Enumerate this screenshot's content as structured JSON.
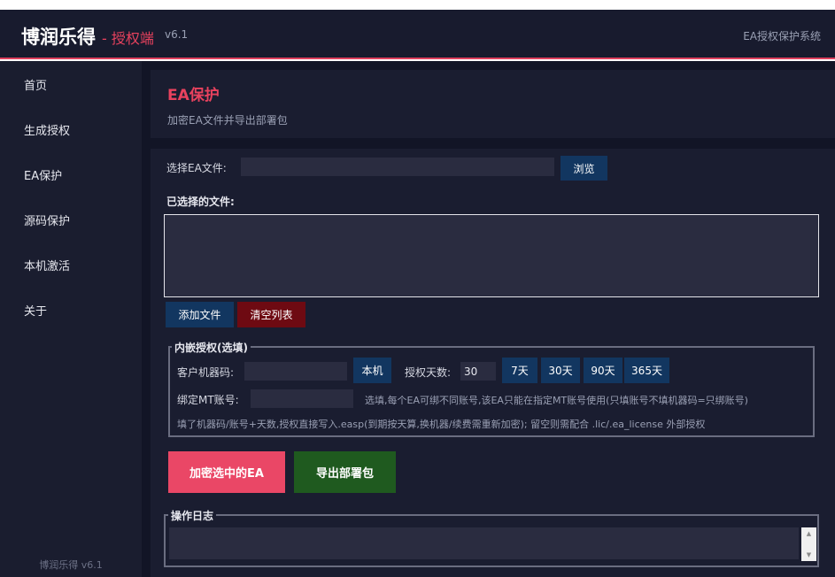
{
  "header": {
    "brand": "博润乐得",
    "brand_sub": "- 授权端",
    "version": "v6.1",
    "right_title": "EA授权保护系统"
  },
  "sidebar": {
    "items": [
      {
        "label": "首页"
      },
      {
        "label": "生成授权"
      },
      {
        "label": "EA保护"
      },
      {
        "label": "源码保护"
      },
      {
        "label": "本机激活"
      },
      {
        "label": "关于"
      }
    ],
    "footer": "博润乐得 v6.1"
  },
  "page": {
    "title": "EA保护",
    "subtitle": "加密EA文件并导出部署包"
  },
  "file_select": {
    "label": "选择EA文件:",
    "value": "",
    "browse_label": "浏览"
  },
  "selected_files": {
    "label": "已选择的文件:",
    "add_label": "添加文件",
    "clear_label": "清空列表"
  },
  "embedded_auth": {
    "legend": "内嵌授权(选填)",
    "machine_code_label": "客户机器码:",
    "machine_code_value": "",
    "local_button": "本机",
    "days_label": "授权天数:",
    "days_value": "30",
    "day_buttons": [
      "7天",
      "30天",
      "90天",
      "365天"
    ],
    "mt_account_label": "绑定MT账号:",
    "mt_account_value": "",
    "mt_hint": "选填,每个EA可绑不同账号,该EA只能在指定MT账号使用(只填账号不填机器码=只绑账号)",
    "bottom_hint": "填了机器码/账号+天数,授权直接写入.easp(到期按天算,换机器/续费需重新加密); 留空则需配合 .lic/.ea_license 外部授权"
  },
  "actions": {
    "encrypt_label": "加密选中的EA",
    "export_label": "导出部署包"
  },
  "log": {
    "legend": "操作日志"
  },
  "colors": {
    "accent": "#e8425e",
    "sidebar_bg": "#1a1d2f",
    "main_bg": "#121526",
    "button_blue": "#123660",
    "button_darkred": "#6e0a12",
    "encrypt_bg": "#ea4766",
    "export_bg": "#1f5a1f"
  }
}
